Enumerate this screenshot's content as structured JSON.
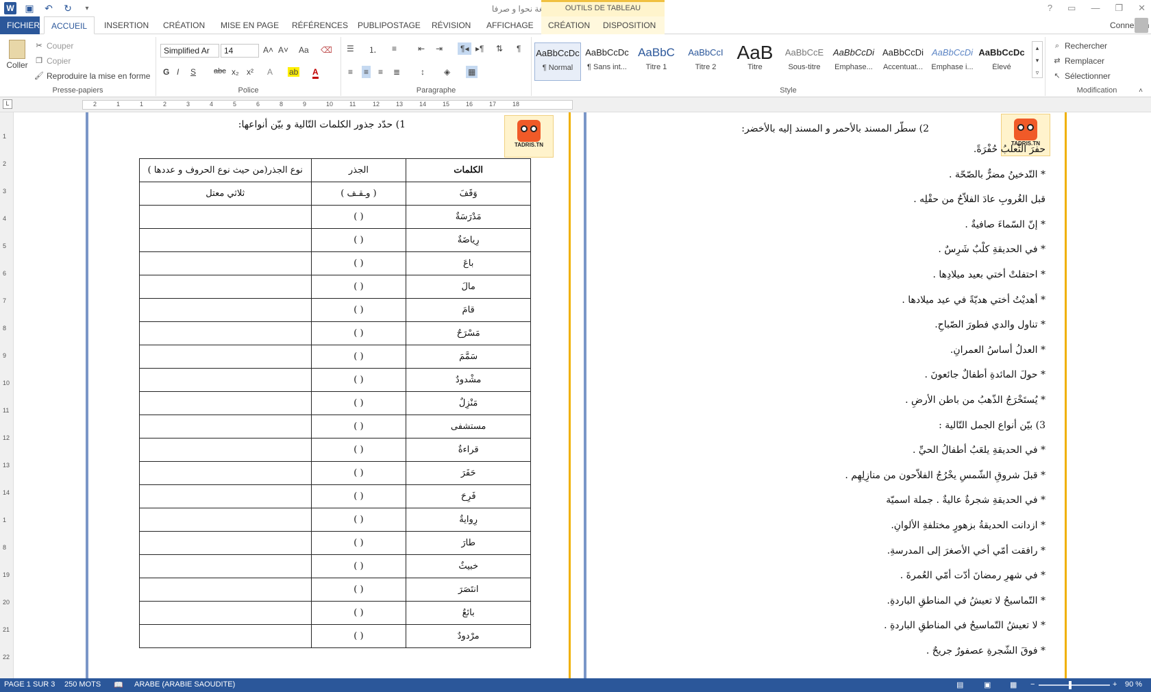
{
  "titlebar": {
    "title": "لغة نحوا و صرفا [Mode de compatibilité] - Word",
    "tools_label": "OUTILS DE TABLEAU",
    "help": "?",
    "min": "—",
    "restore": "❐",
    "close": "✕"
  },
  "tabs": {
    "file": "FICHIER",
    "home": "ACCUEIL",
    "insert": "INSERTION",
    "design": "CRÉATION",
    "layout": "MISE EN PAGE",
    "references": "RÉFÉRENCES",
    "mailings": "PUBLIPOSTAGE",
    "review": "RÉVISION",
    "view": "AFFICHAGE",
    "tbl_design": "CRÉATION",
    "tbl_layout": "DISPOSITION",
    "account": "Connexion"
  },
  "clipboard": {
    "paste": "Coller",
    "cut": "Couper",
    "copy": "Copier",
    "painter": "Reproduire la mise en forme",
    "label": "Presse-papiers"
  },
  "font": {
    "name": "Simplified Ar",
    "size": "14",
    "label": "Police",
    "bold": "G",
    "italic": "I",
    "underline": "S",
    "strike": "abc",
    "sub": "x₂",
    "sup": "x²",
    "grow": "A˄",
    "shrink": "A˅",
    "case": "Aa"
  },
  "paragraph": {
    "label": "Paragraphe"
  },
  "styles": {
    "label": "Style",
    "items": [
      {
        "preview": "AaBbCcDc",
        "name": "¶ Normal"
      },
      {
        "preview": "AaBbCcDc",
        "name": "¶ Sans int..."
      },
      {
        "preview": "AaBbC",
        "name": "Titre 1"
      },
      {
        "preview": "AaBbCcI",
        "name": "Titre 2"
      },
      {
        "preview": "AaB",
        "name": "Titre"
      },
      {
        "preview": "AaBbCcE",
        "name": "Sous-titre"
      },
      {
        "preview": "AaBbCcDi",
        "name": "Emphase..."
      },
      {
        "preview": "AaBbCcDi",
        "name": "Accentuat..."
      },
      {
        "preview": "AaBbCcDi",
        "name": "Emphase i..."
      },
      {
        "preview": "AaBbCcDc",
        "name": "Élevé"
      }
    ]
  },
  "editing": {
    "find": "Rechercher",
    "replace": "Remplacer",
    "select": "Sélectionner",
    "label": "Modification"
  },
  "ruler": {
    "ticks": [
      "2",
      "1",
      "1",
      "2",
      "3",
      "4",
      "5",
      "6",
      "8",
      "9",
      "10",
      "11",
      "12",
      "13",
      "14",
      "15",
      "16",
      "17",
      "18"
    ]
  },
  "vruler": {
    "ticks": [
      "1",
      "2",
      "3",
      "4",
      "5",
      "6",
      "7",
      "8",
      "9",
      "10",
      "11",
      "12",
      "13",
      "14",
      "1",
      "8",
      "19",
      "20",
      "21",
      "22"
    ]
  },
  "left_page": {
    "mascot": "TADRIS.TN",
    "q1": "1) حدّد جذور الكلمات التّالية و بيّن أنواعها:",
    "headers": {
      "word": "الكلمات",
      "root": "الجذر",
      "type": "نوع الجذر(من حيث نوع الحروف و عددها )"
    },
    "rows": [
      {
        "word": "وَقَفَ",
        "root": "( وـقـف )",
        "type": "ثلاثي معتل"
      },
      {
        "word": "مَدْرَسَةٌ",
        "root": "(      )",
        "type": ""
      },
      {
        "word": "رِياضَةٌ",
        "root": "(         )",
        "type": ""
      },
      {
        "word": "باعَ",
        "root": "(       )",
        "type": ""
      },
      {
        "word": "مالَ",
        "root": "(       )",
        "type": ""
      },
      {
        "word": "قامَ",
        "root": "(       )",
        "type": ""
      },
      {
        "word": "مَسْرَحٌ",
        "root": "(       )",
        "type": ""
      },
      {
        "word": "سَمَّمَ",
        "root": "(       )",
        "type": ""
      },
      {
        "word": "مشْدودٌ",
        "root": "(         )",
        "type": ""
      },
      {
        "word": "مَنْزِلٌ",
        "root": "(       )",
        "type": ""
      },
      {
        "word": "مستشفى",
        "root": "(       )",
        "type": ""
      },
      {
        "word": "قراءةٌ",
        "root": "(       )",
        "type": ""
      },
      {
        "word": "حَفَرَ",
        "root": "(       )",
        "type": ""
      },
      {
        "word": "فَرِحَ",
        "root": "(     )",
        "type": ""
      },
      {
        "word": "رِوايةٌ",
        "root": "(       )",
        "type": ""
      },
      {
        "word": "طارَ",
        "root": "(         )",
        "type": ""
      },
      {
        "word": "خبيثٌ",
        "root": "(       )",
        "type": ""
      },
      {
        "word": "انتَصَرَ",
        "root": "(       )",
        "type": ""
      },
      {
        "word": "بائعٌ",
        "root": "(       )",
        "type": ""
      },
      {
        "word": "مرْدودٌ",
        "root": "(       )",
        "type": ""
      }
    ]
  },
  "right_page": {
    "mascot": "TADRIS.TN",
    "q2": "2) سطّر المسند بالأحمر و المسند إليه بالأخضر:",
    "lines": [
      "حفرَ الثّعلبُ حُفْرَةً.",
      "* التّدخينُ مضرٌّ بالصّحّة .",
      "قبل الغُروبِ عادَ الفلاّحُ من حقْلِه .",
      "* إنّ السّماءَ صافيةٌ .",
      "* في الحديقةِ كلْبٌ شَرِسٌ .",
      "* احتفلتْ أختي بعيد ميلادِها .",
      "* أهديْتُ أختي هديّةً في عيد ميلادها .",
      "* تناول والدي فطورَ الصّباحِ.",
      "* العدلُ أساسُ العمرانِ.",
      "* حولَ المائدةِ أطفالٌ جائعونَ .",
      "* يُستَخْرَجُ الذّهبُ من باطن الأرضِ .",
      "3) بيّن أنواع الجمل التّالية :",
      "* في الحديقةِ يلعَبُ أطفالُ الحيِّ .",
      "* قبلَ شروقِ الشّمسِ يخْرُجُ الفلاّحون من منازِلِهِم .",
      "* في الحديقةِ شجرةٌ عاليةٌ . جملة اسميّة",
      "* ازدانت الحديقةُ بزهورٍ مختلفةِ الألوانِ.",
      "* رافقت أمّي أخي الأصغرَ إلى المدرسةِ.",
      "* في شهرِ رمضانَ أدّت أمّي العُمرةَ .",
      "* التّماسيحُ لا تعيشُ في المناطقِ الباردةِ.",
      "* لا تعيشُ التّماسيحُ في المناطقِ الباردةِ .",
      "* فوقَ الشّجرةِ عصفورٌ جريحٌ ."
    ]
  },
  "status": {
    "page": "PAGE 1 SUR 3",
    "words": "250 MOTS",
    "lang": "ARABE (ARABIE SAOUDITE)",
    "zoom": "90 %"
  },
  "colors": {
    "accent": "#2b579a",
    "tool_tab": "#fff4cc",
    "red": "#c00000"
  }
}
